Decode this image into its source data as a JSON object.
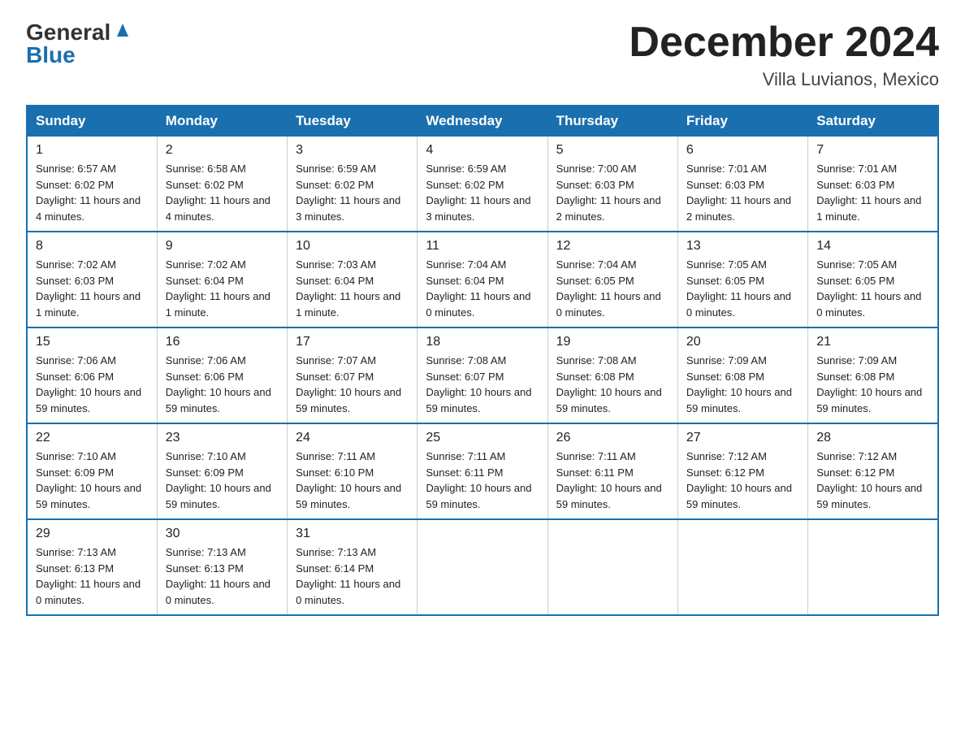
{
  "logo": {
    "text_general": "General",
    "text_blue": "Blue"
  },
  "header": {
    "month_title": "December 2024",
    "location": "Villa Luvianos, Mexico"
  },
  "weekdays": [
    "Sunday",
    "Monday",
    "Tuesday",
    "Wednesday",
    "Thursday",
    "Friday",
    "Saturday"
  ],
  "weeks": [
    [
      {
        "day": "1",
        "sunrise": "6:57 AM",
        "sunset": "6:02 PM",
        "daylight": "11 hours and 4 minutes."
      },
      {
        "day": "2",
        "sunrise": "6:58 AM",
        "sunset": "6:02 PM",
        "daylight": "11 hours and 4 minutes."
      },
      {
        "day": "3",
        "sunrise": "6:59 AM",
        "sunset": "6:02 PM",
        "daylight": "11 hours and 3 minutes."
      },
      {
        "day": "4",
        "sunrise": "6:59 AM",
        "sunset": "6:02 PM",
        "daylight": "11 hours and 3 minutes."
      },
      {
        "day": "5",
        "sunrise": "7:00 AM",
        "sunset": "6:03 PM",
        "daylight": "11 hours and 2 minutes."
      },
      {
        "day": "6",
        "sunrise": "7:01 AM",
        "sunset": "6:03 PM",
        "daylight": "11 hours and 2 minutes."
      },
      {
        "day": "7",
        "sunrise": "7:01 AM",
        "sunset": "6:03 PM",
        "daylight": "11 hours and 1 minute."
      }
    ],
    [
      {
        "day": "8",
        "sunrise": "7:02 AM",
        "sunset": "6:03 PM",
        "daylight": "11 hours and 1 minute."
      },
      {
        "day": "9",
        "sunrise": "7:02 AM",
        "sunset": "6:04 PM",
        "daylight": "11 hours and 1 minute."
      },
      {
        "day": "10",
        "sunrise": "7:03 AM",
        "sunset": "6:04 PM",
        "daylight": "11 hours and 1 minute."
      },
      {
        "day": "11",
        "sunrise": "7:04 AM",
        "sunset": "6:04 PM",
        "daylight": "11 hours and 0 minutes."
      },
      {
        "day": "12",
        "sunrise": "7:04 AM",
        "sunset": "6:05 PM",
        "daylight": "11 hours and 0 minutes."
      },
      {
        "day": "13",
        "sunrise": "7:05 AM",
        "sunset": "6:05 PM",
        "daylight": "11 hours and 0 minutes."
      },
      {
        "day": "14",
        "sunrise": "7:05 AM",
        "sunset": "6:05 PM",
        "daylight": "11 hours and 0 minutes."
      }
    ],
    [
      {
        "day": "15",
        "sunrise": "7:06 AM",
        "sunset": "6:06 PM",
        "daylight": "10 hours and 59 minutes."
      },
      {
        "day": "16",
        "sunrise": "7:06 AM",
        "sunset": "6:06 PM",
        "daylight": "10 hours and 59 minutes."
      },
      {
        "day": "17",
        "sunrise": "7:07 AM",
        "sunset": "6:07 PM",
        "daylight": "10 hours and 59 minutes."
      },
      {
        "day": "18",
        "sunrise": "7:08 AM",
        "sunset": "6:07 PM",
        "daylight": "10 hours and 59 minutes."
      },
      {
        "day": "19",
        "sunrise": "7:08 AM",
        "sunset": "6:08 PM",
        "daylight": "10 hours and 59 minutes."
      },
      {
        "day": "20",
        "sunrise": "7:09 AM",
        "sunset": "6:08 PM",
        "daylight": "10 hours and 59 minutes."
      },
      {
        "day": "21",
        "sunrise": "7:09 AM",
        "sunset": "6:08 PM",
        "daylight": "10 hours and 59 minutes."
      }
    ],
    [
      {
        "day": "22",
        "sunrise": "7:10 AM",
        "sunset": "6:09 PM",
        "daylight": "10 hours and 59 minutes."
      },
      {
        "day": "23",
        "sunrise": "7:10 AM",
        "sunset": "6:09 PM",
        "daylight": "10 hours and 59 minutes."
      },
      {
        "day": "24",
        "sunrise": "7:11 AM",
        "sunset": "6:10 PM",
        "daylight": "10 hours and 59 minutes."
      },
      {
        "day": "25",
        "sunrise": "7:11 AM",
        "sunset": "6:11 PM",
        "daylight": "10 hours and 59 minutes."
      },
      {
        "day": "26",
        "sunrise": "7:11 AM",
        "sunset": "6:11 PM",
        "daylight": "10 hours and 59 minutes."
      },
      {
        "day": "27",
        "sunrise": "7:12 AM",
        "sunset": "6:12 PM",
        "daylight": "10 hours and 59 minutes."
      },
      {
        "day": "28",
        "sunrise": "7:12 AM",
        "sunset": "6:12 PM",
        "daylight": "10 hours and 59 minutes."
      }
    ],
    [
      {
        "day": "29",
        "sunrise": "7:13 AM",
        "sunset": "6:13 PM",
        "daylight": "11 hours and 0 minutes."
      },
      {
        "day": "30",
        "sunrise": "7:13 AM",
        "sunset": "6:13 PM",
        "daylight": "11 hours and 0 minutes."
      },
      {
        "day": "31",
        "sunrise": "7:13 AM",
        "sunset": "6:14 PM",
        "daylight": "11 hours and 0 minutes."
      },
      null,
      null,
      null,
      null
    ]
  ],
  "labels": {
    "sunrise": "Sunrise:",
    "sunset": "Sunset:",
    "daylight": "Daylight:"
  },
  "colors": {
    "header_bg": "#1a6faf",
    "header_text": "#ffffff",
    "border": "#1a6faf",
    "text": "#222222"
  }
}
